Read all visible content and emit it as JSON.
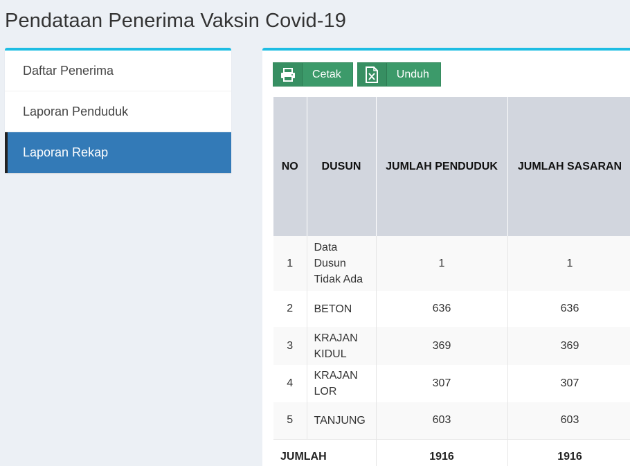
{
  "page": {
    "title": "Pendataan Penerima Vaksin Covid-19"
  },
  "sidebar": {
    "items": [
      {
        "label": "Daftar Penerima"
      },
      {
        "label": "Laporan Penduduk"
      },
      {
        "label": "Laporan Rekap",
        "active": true
      }
    ]
  },
  "toolbar": {
    "print_label": "Cetak",
    "download_label": "Unduh",
    "print_icon": "printer-icon",
    "download_icon": "excel-file-icon"
  },
  "table": {
    "headers": [
      "NO",
      "DUSUN",
      "JUMLAH PENDUDUK",
      "JUMLAH SASARAN"
    ],
    "rows": [
      {
        "no": "1",
        "dusun": "Data Dusun Tidak Ada",
        "penduduk": "1",
        "sasaran": "1"
      },
      {
        "no": "2",
        "dusun": "BETON",
        "penduduk": "636",
        "sasaran": "636"
      },
      {
        "no": "3",
        "dusun": "KRAJAN KIDUL",
        "penduduk": "369",
        "sasaran": "369"
      },
      {
        "no": "4",
        "dusun": "KRAJAN LOR",
        "penduduk": "307",
        "sasaran": "307"
      },
      {
        "no": "5",
        "dusun": "TANJUNG",
        "penduduk": "603",
        "sasaran": "603"
      }
    ],
    "total": {
      "label": "JUMLAH",
      "penduduk": "1916",
      "sasaran": "1916"
    }
  },
  "colors": {
    "accent": "#1ebde3",
    "active": "#337ab7",
    "button": "#3c9a6a",
    "header": "#d2d6de"
  }
}
